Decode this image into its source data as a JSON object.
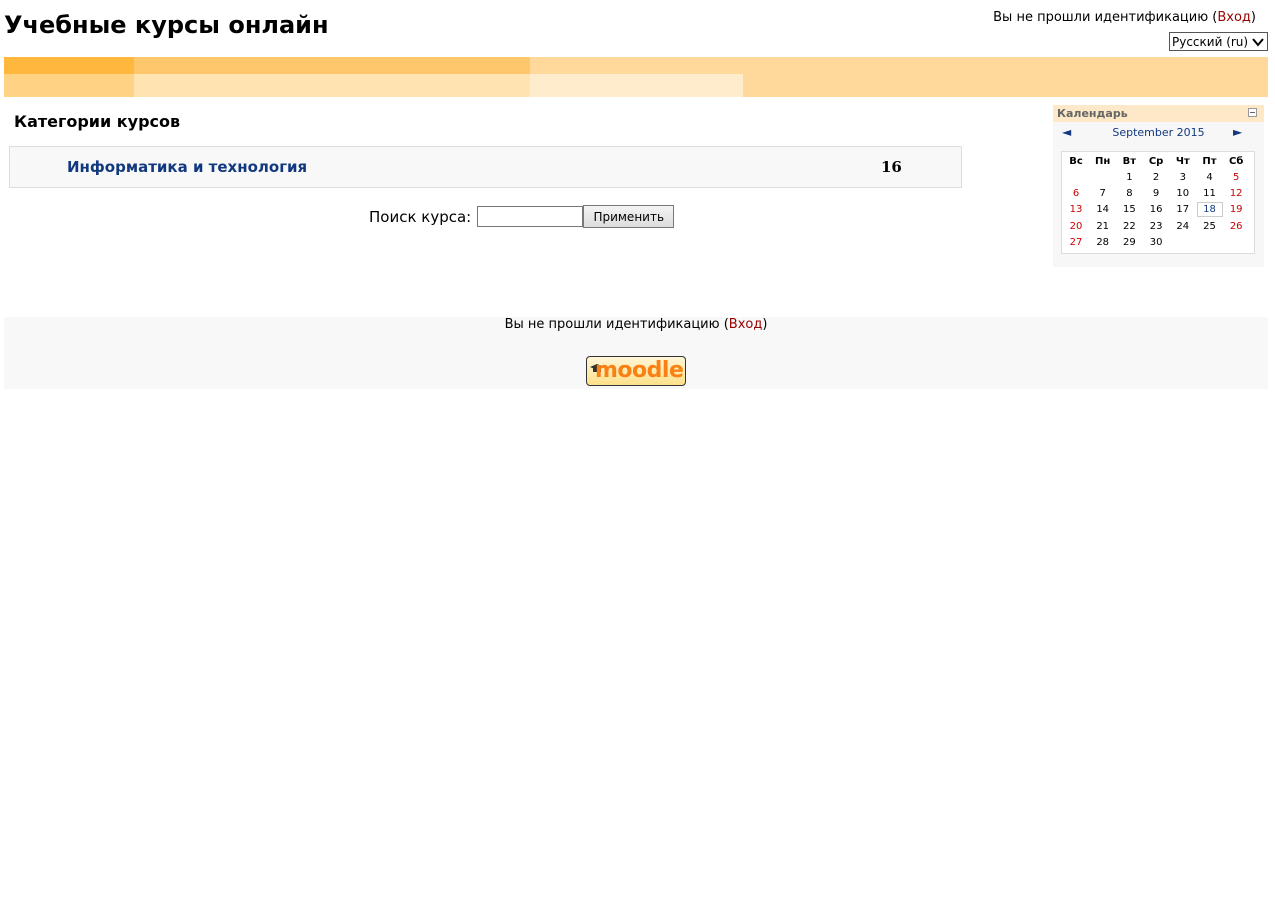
{
  "header": {
    "site_title": "Учебные курсы онлайн",
    "login_prefix": "Вы не прошли идентификацию (",
    "login_link": "Вход",
    "login_suffix": ")",
    "language": "Русский (ru)"
  },
  "main": {
    "heading": "Категории курсов",
    "categories": [
      {
        "name": "Информатика и технология",
        "count": "16"
      }
    ],
    "search_label": "Поиск курса:",
    "search_value": "",
    "search_button": "Применить"
  },
  "calendar": {
    "title": "Календарь",
    "prev": "◄",
    "next": "►",
    "month": "September 2015",
    "daynames": [
      "Вс",
      "Пн",
      "Вт",
      "Ср",
      "Чт",
      "Пт",
      "Сб"
    ],
    "weeks": [
      [
        "",
        "",
        "1",
        "2",
        "3",
        "4",
        "5"
      ],
      [
        "6",
        "7",
        "8",
        "9",
        "10",
        "11",
        "12"
      ],
      [
        "13",
        "14",
        "15",
        "16",
        "17",
        "18",
        "19"
      ],
      [
        "20",
        "21",
        "22",
        "23",
        "24",
        "25",
        "26"
      ],
      [
        "27",
        "28",
        "29",
        "30",
        "",
        "",
        ""
      ]
    ],
    "today": "18",
    "weekend_color": "#cc0000",
    "today_color": "#12397f"
  },
  "footer": {
    "login_prefix": "Вы не прошли идентификацию (",
    "login_link": "Вход",
    "login_suffix": ")",
    "logo_text": "moodle"
  },
  "colors": {
    "link": "#12397f",
    "login_link": "#990000",
    "band_base": "#ffd99b"
  }
}
